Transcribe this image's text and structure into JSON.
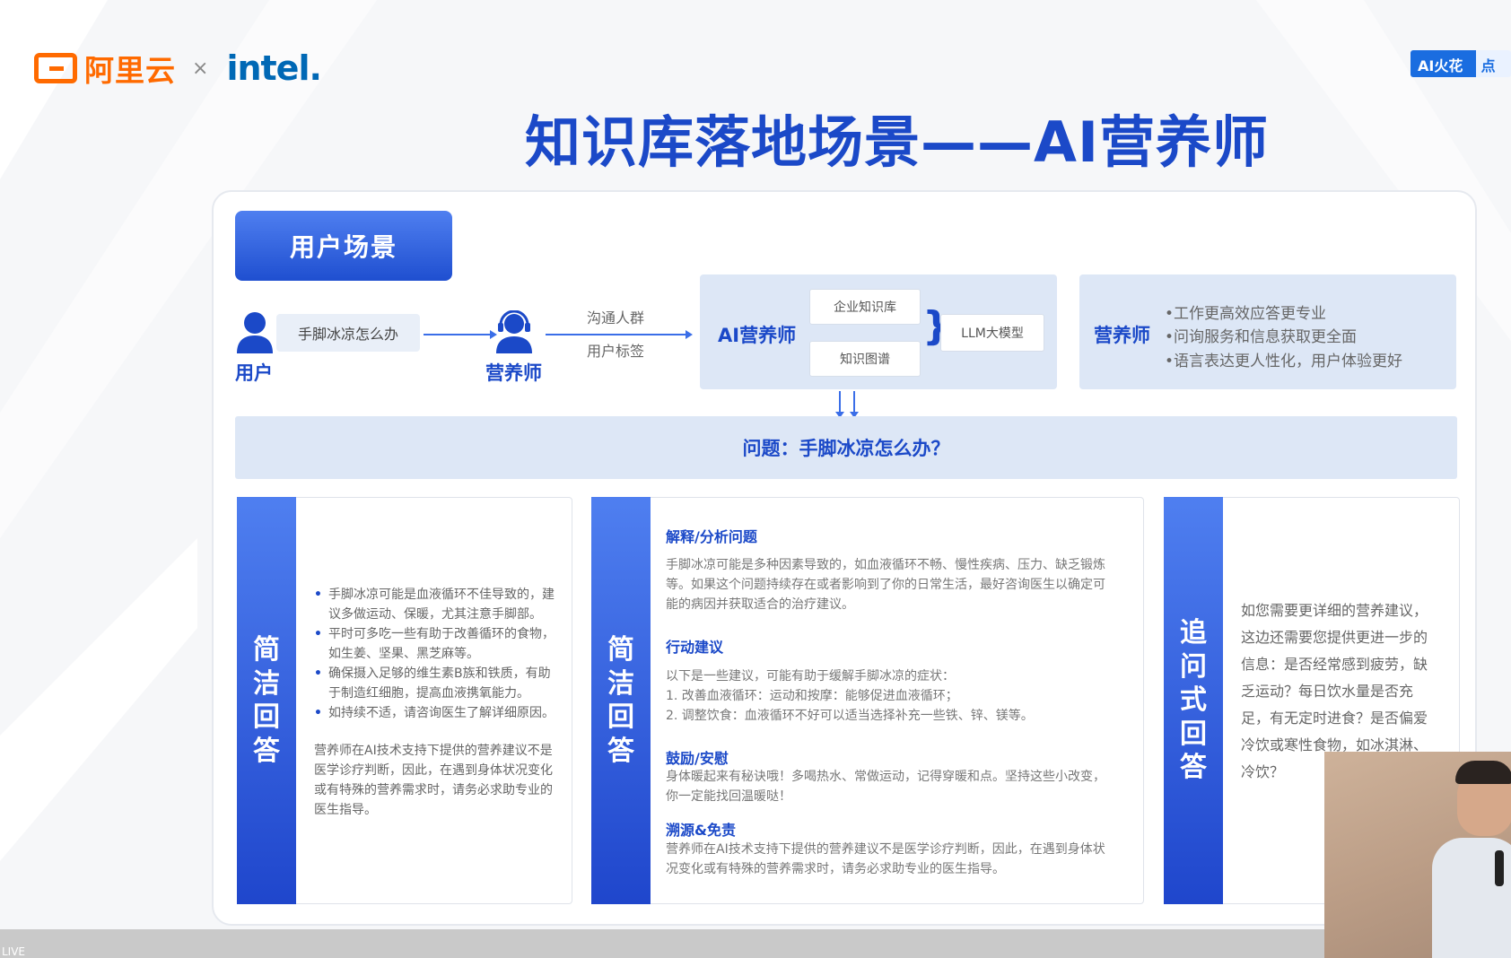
{
  "header": {
    "aliyun_text": "阿里云",
    "times": "×",
    "intel_text": "intel.",
    "badge_left": "AI火花会",
    "badge_right": "点亮",
    "title": "知识库落地场景——AI营养师"
  },
  "scene_tab": "用户场景",
  "flow": {
    "user_label": "用户",
    "user_question": "手脚冰凉怎么办",
    "nutritionist_label": "营养师",
    "tag_top": "沟通人群",
    "tag_bottom": "用户标签",
    "ai_title": "AI营养师",
    "kb1": "企业知识库",
    "kb2": "知识图谱",
    "llm": "LLM大模型",
    "nutri_title": "营养师",
    "benefits": [
      "•工作更高效应答更专业",
      "•问询服务和信息获取更全面",
      "•语言表达更人性化，用户体验更好"
    ]
  },
  "question": "问题：手脚冰凉怎么办？",
  "col1": {
    "side": [
      "简",
      "洁",
      "回",
      "答"
    ],
    "bullets": [
      "手脚冰凉可能是血液循环不佳导致的，建议多做运动、保暖，尤其注意手脚部。",
      "平时可多吃一些有助于改善循环的食物，如生姜、坚果、黑芝麻等。",
      "确保摄入足够的维生素B族和铁质，有助于制造红细胞，提高血液携氧能力。",
      "如持续不适，请咨询医生了解详细原因。"
    ],
    "disclaimer": "营养师在AI技术支持下提供的营养建议不是医学诊疗判断，因此，在遇到身体状况变化或有特殊的营养需求时，请务必求助专业的医生指导。"
  },
  "col2": {
    "side": [
      "简",
      "洁",
      "回",
      "答"
    ],
    "h1": "解释/分析问题",
    "p1": "手脚冰凉可能是多种因素导致的，如血液循环不畅、慢性疾病、压力、缺乏锻炼等。如果这个问题持续存在或者影响到了你的日常生活，最好咨询医生以确定可能的病因并获取适合的治疗建议。",
    "h2": "行动建议",
    "p2a": "以下是一些建议，可能有助于缓解手脚冰凉的症状：",
    "p2b": "1. 改善血液循环：运动和按摩：能够促进血液循环；",
    "p2c": "2. 调整饮食：血液循环不好可以适当选择补充一些铁、锌、镁等。",
    "h3": "鼓励/安慰",
    "p3": "身体暖起来有秘诀哦！多喝热水、常做运动，记得穿暖和点。坚持这些小改变，你一定能找回温暖哒！",
    "h4": "溯源&免责",
    "p4": "营养师在AI技术支持下提供的营养建议不是医学诊疗判断，因此，在遇到身体状况变化或有特殊的营养需求时，请务必求助专业的医生指导。"
  },
  "col3": {
    "side": [
      "追",
      "问",
      "式",
      "回",
      "答"
    ],
    "text": "如您需要更详细的营养建议，这边还需要您提供更进一步的信息：是否经常感到疲劳，缺乏运动？每日饮水量是否充足，有无定时进食？是否偏爱冷饮或寒性食物，如冰淇淋、冷饮？"
  },
  "live_label": "LIVE",
  "colors": {
    "primary": "#1b49c8",
    "aliyun": "#ff6a00",
    "intel": "#0068b5",
    "panel": "#dde7f6"
  }
}
